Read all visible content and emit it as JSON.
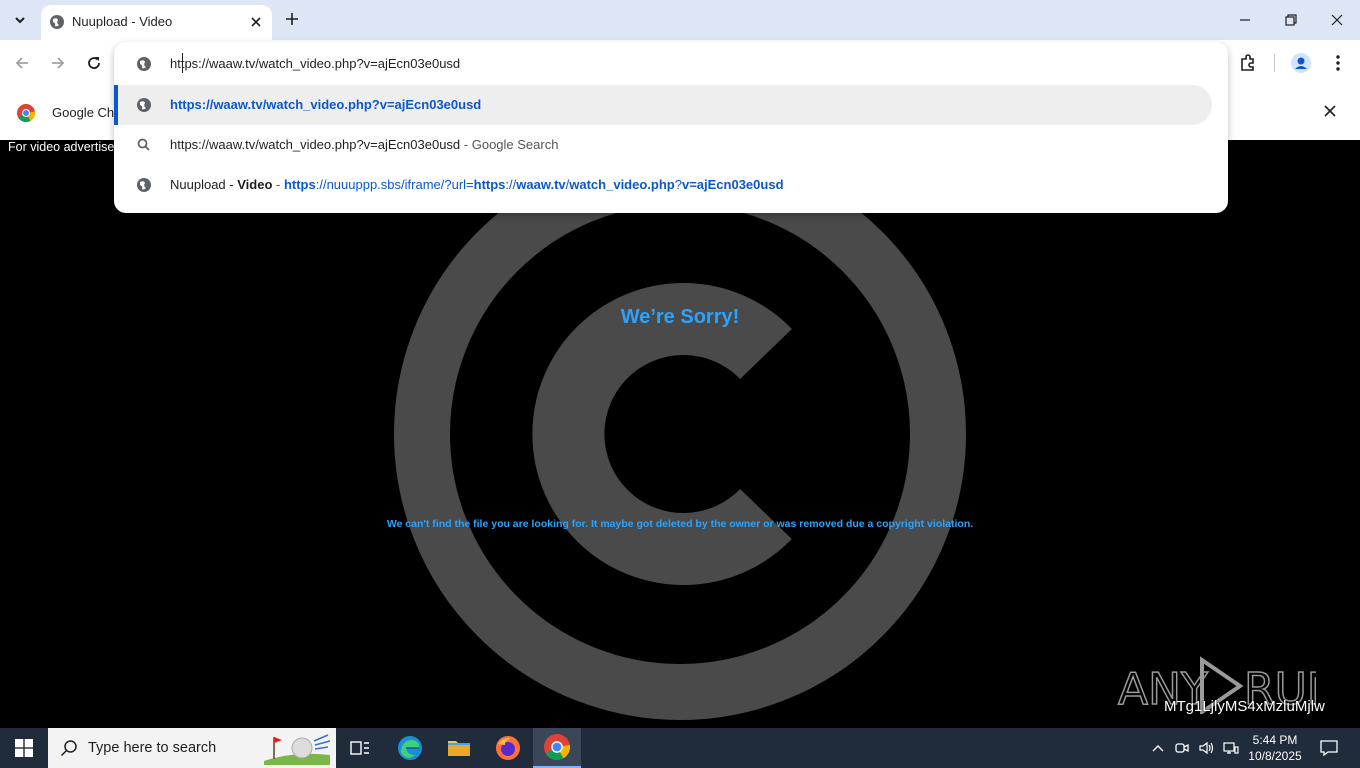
{
  "browser": {
    "tab_title": "Nuupload - Video",
    "infobar_text": "Google Ch"
  },
  "omnibox": {
    "input_value": "https://waaw.tv/watch_video.php?v=ajEcn03e0usd",
    "suggestions": [
      {
        "url_bold": "https://waaw.tv/watch_video.php?v=ajEcn03e0usd"
      },
      {
        "query": "https://waaw.tv/watch_video.php?v=ajEcn03e0usd",
        "suffix": " - Google Search"
      },
      {
        "title_a": "Nuupload - ",
        "title_b": "Video",
        "sep": " - ",
        "url_p1": "https",
        "url_p2": "://nuuuppp.sbs/iframe/?url=",
        "url_p3": "https",
        "url_p4": "://",
        "url_p5": "waaw.tv",
        "url_p6": "/",
        "url_p7": "watch_video.php",
        "url_p8": "?",
        "url_p9": "v=ajEcn03e0usd"
      }
    ]
  },
  "page": {
    "ad_note": "For video advertise",
    "heading": "We’re Sorry!",
    "message": "We can't find the file you are looking for. It maybe got deleted by the owner or was removed due a copyright violation.",
    "watermark_id": "MTg1LjlyMS4xMzluMjlw"
  },
  "taskbar": {
    "search_placeholder": "Type here to search",
    "time": "5:44 PM",
    "date": "10/8/2025"
  },
  "colors": {
    "accent_blue": "#0b57d0",
    "page_text_blue": "#2aa3ff",
    "titlebar": "#dce6f4",
    "taskbar": "#202b3c"
  }
}
